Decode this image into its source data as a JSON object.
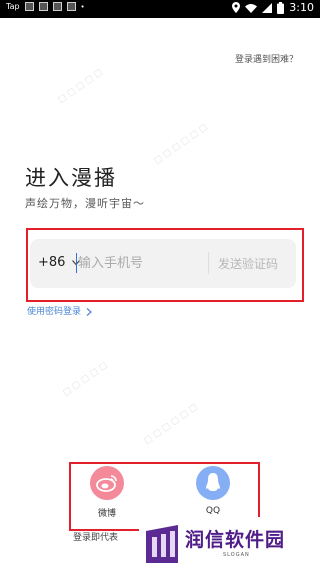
{
  "status_bar": {
    "app_label": "Tap",
    "time": "3:10",
    "icons": [
      "notification-icon",
      "location-icon",
      "wifi-icon",
      "signal-icon",
      "battery-icon"
    ]
  },
  "header": {
    "help_link": "登录遇到困难？"
  },
  "main": {
    "title": "进入漫播",
    "subtitle": "声绘万物，漫听宇宙～",
    "country_code": "+86",
    "phone_placeholder": "输入手机号",
    "send_code_label": "发送验证码",
    "password_login_label": "使用密码登录"
  },
  "social_login": [
    {
      "label": "微博",
      "icon": "weibo-icon",
      "color": "#f4899a"
    },
    {
      "label": "QQ",
      "icon": "qq-icon",
      "color": "#86aef5"
    }
  ],
  "footer": {
    "agreement_text": "登录即代表"
  },
  "watermark": {
    "brand": "润信软件园",
    "slogan": "SLOGAN"
  },
  "colors": {
    "accent_blue": "#4a86d8",
    "annotation_red": "#e21f2b",
    "watermark_purple": "#4f1c88"
  }
}
